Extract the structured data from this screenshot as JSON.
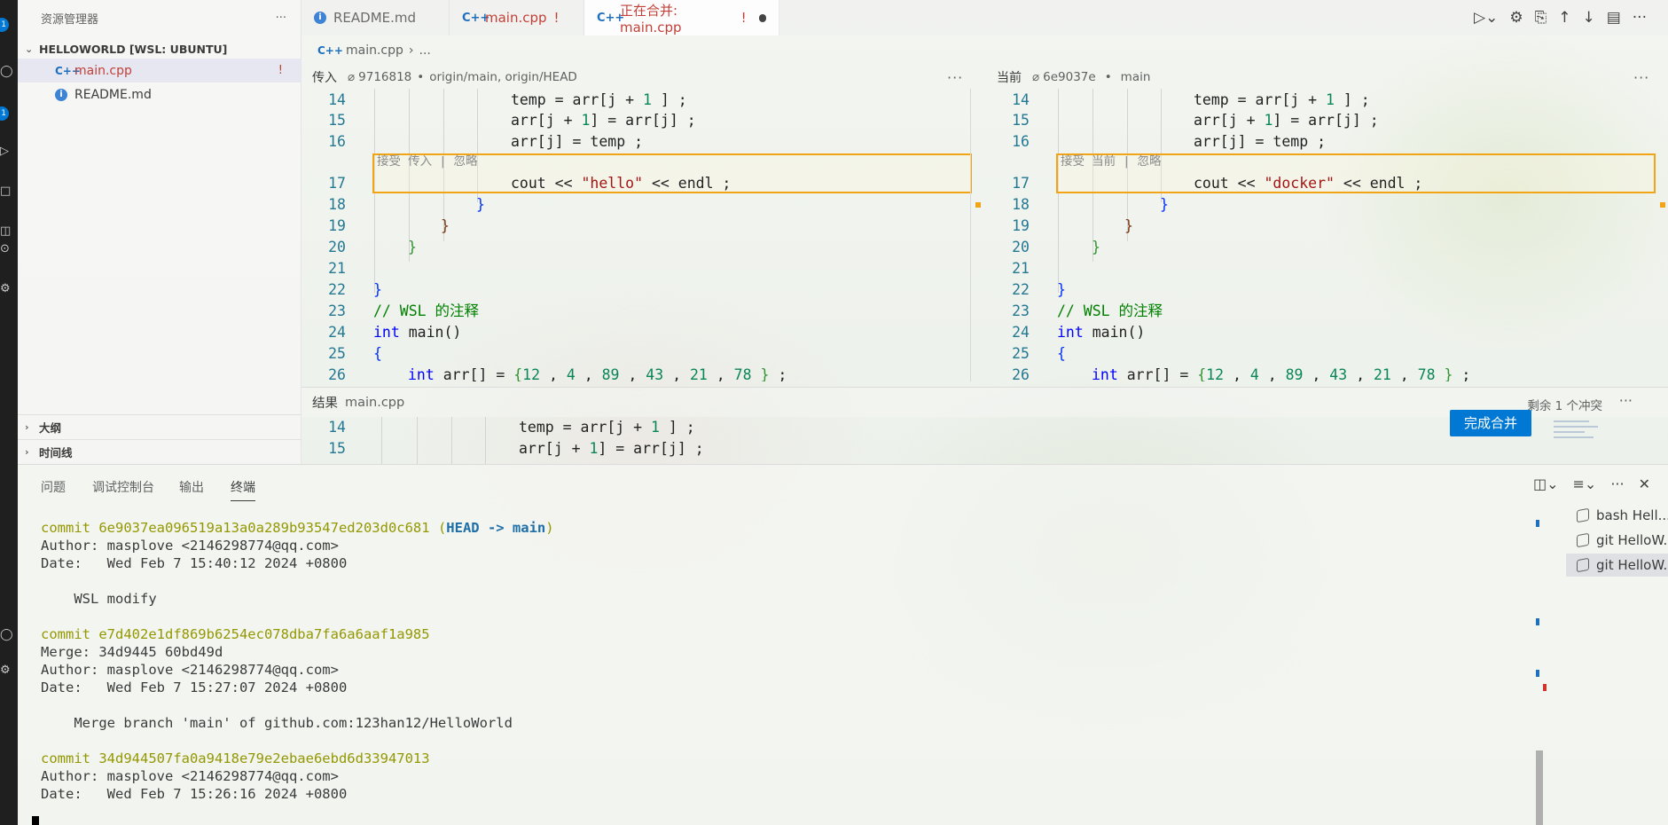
{
  "activity_bar": {
    "badge_top": "1",
    "badge_mid": "1"
  },
  "sidebar": {
    "title": "资源管理器",
    "more": "···",
    "workspace": "HELLOWORLD [WSL: UBUNTU]",
    "files": [
      {
        "name": "main.cpp",
        "type": "C++",
        "status": "!"
      },
      {
        "name": "README.md",
        "type": "info"
      }
    ],
    "outline": "大纲",
    "timeline": "时间线"
  },
  "tabs": [
    {
      "label": "README.md",
      "icon": "info-icon"
    },
    {
      "label": "main.cpp",
      "icon": "cpp-icon",
      "status": "!"
    },
    {
      "label": "正在合并: main.cpp",
      "icon": "cpp-icon",
      "status": "!"
    }
  ],
  "breadcrumb": {
    "file": "main.cpp",
    "rest": "..."
  },
  "incoming": {
    "label": "传入",
    "commit": "9716818",
    "refs": "origin/main, origin/HEAD",
    "codelens": "接受 传入 | 忽略",
    "conflict_text": "\"hello\""
  },
  "current": {
    "label": "当前",
    "commit": "6e9037e",
    "refs": "main",
    "codelens": "接受 当前 | 忽略",
    "conflict_text": "\"docker\""
  },
  "code": {
    "line_numbers": [
      "14",
      "15",
      "16",
      "17",
      "18",
      "19",
      "20",
      "21",
      "22",
      "23",
      "24",
      "25",
      "26"
    ],
    "comment": "// WSL 的注释"
  },
  "result": {
    "label": "结果",
    "file": "main.cpp",
    "remaining": "剩余 1 个冲突",
    "finish_button": "完成合并",
    "line_numbers": [
      "14",
      "15"
    ]
  },
  "panel": {
    "tabs": [
      "问题",
      "调试控制台",
      "输出",
      "终端"
    ],
    "active_tab": "终端",
    "terminal": [
      {
        "hash": "6e9037ea096519a13a0a289b93547ed203d0c681",
        "head": "HEAD -> main"
      },
      {
        "author": "Author: masplove <2146298774@qq.com>"
      },
      {
        "date": "Date:   Wed Feb 7 15:40:12 2024 +0800"
      },
      {
        "msg": "    WSL modify"
      },
      {
        "hash": "e7d402e1df869b6254ec078dba7fa6a6aaf1a985"
      },
      {
        "merge": "Merge: 34d9445 60bd49d"
      },
      {
        "author": "Author: masplove <2146298774@qq.com>"
      },
      {
        "date": "Date:   Wed Feb 7 15:27:07 2024 +0800"
      },
      {
        "msg": "    Merge branch 'main' of github.com:123han12/HelloWorld"
      },
      {
        "hash": "34d944507fa0a9418e79e2ebae6ebd6d33947013"
      },
      {
        "author": "Author: masplove <2146298774@qq.com>"
      },
      {
        "date": "Date:   Wed Feb 7 15:26:16 2024 +0800"
      }
    ],
    "terminals": [
      "bash Hell...",
      "git HelloW...",
      "git HelloW..."
    ]
  },
  "colors": {
    "accent": "#0078d4",
    "conflict": "#f0a416",
    "modified": "#c24038"
  }
}
